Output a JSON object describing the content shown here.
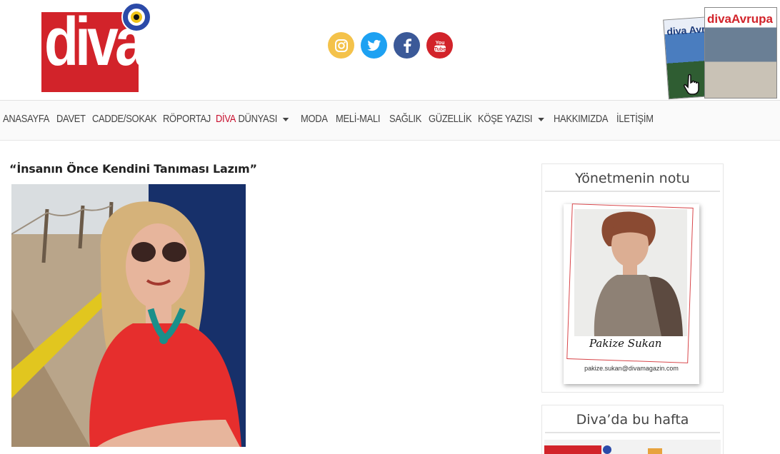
{
  "logo": {
    "text": "diva",
    "accent_color": "#d2232a"
  },
  "social": [
    {
      "name": "instagram-icon",
      "color": "#f4c24a"
    },
    {
      "name": "twitter-icon",
      "color": "#1da1f2"
    },
    {
      "name": "facebook-icon",
      "color": "#3b5998"
    },
    {
      "name": "youtube-icon",
      "color": "#d2232a"
    }
  ],
  "magazine": {
    "cover1_title": "diva Avrupa",
    "cover2_title": "divaAvrupa"
  },
  "nav": {
    "items": [
      {
        "label": "ANASAYFA"
      },
      {
        "label": "DAVET"
      },
      {
        "label": "CADDE/SOKAK"
      },
      {
        "label": "RÖPORTAJ"
      },
      {
        "label_prefix": "DİVA",
        "label": " DÜNYASI",
        "dropdown": true,
        "prefix_color": "#c8102e"
      },
      {
        "label": "MODA"
      },
      {
        "label": "MELİ-MALI"
      },
      {
        "label": "SAĞLIK"
      },
      {
        "label": "GÜZELLİK"
      },
      {
        "label": "KÖŞE YAZISI",
        "dropdown": true
      },
      {
        "label": "HAKKIMIZDA"
      },
      {
        "label": "İLETİŞİM"
      }
    ]
  },
  "article": {
    "title": "“İnsanın Önce Kendini Tanıması Lazım”"
  },
  "sidebar": {
    "editor_widget": {
      "title": "Yönetmenin notu",
      "signature": "Pakize Sukan",
      "email": "pakize.sukan@divamagazin.com"
    },
    "weekly_widget": {
      "title": "Diva’da bu hafta"
    }
  }
}
